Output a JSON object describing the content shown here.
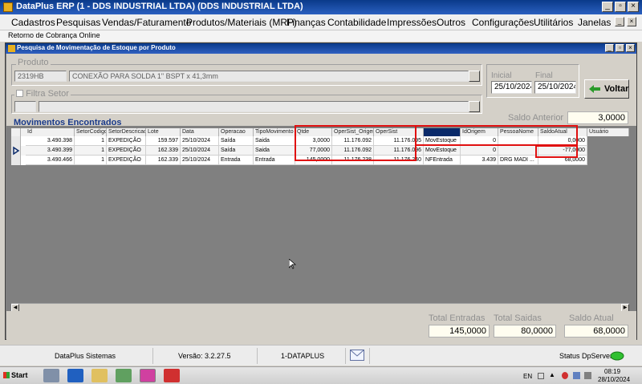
{
  "window": {
    "title": "DataPlus ERP (1 - DDS INDUSTRIAL LTDA)  (DDS INDUSTRIAL LTDA)"
  },
  "menu": [
    "Cadastros",
    "Pesquisas",
    "Vendas/Faturamento",
    "Produtos/Materiais (MRP)",
    "Finanças",
    "Contabilidade",
    "Impressões",
    "Outros",
    "Configurações",
    "Utilitários",
    "Janelas"
  ],
  "subbar": "Retorno de Cobrança Online",
  "child": {
    "title": "Pesquisa de Movimentação de Estoque por Produto"
  },
  "produto": {
    "label": "Produto",
    "code": "2319HB",
    "description": "CONEXÃO PARA SOLDA 1\" BSPT x 41,3mm"
  },
  "filtro_setor": {
    "label": "Filtra Setor"
  },
  "periodo": {
    "inicial_label": "Inicial",
    "inicial": "25/10/2024",
    "final_label": "Final",
    "final": "25/10/2024"
  },
  "voltar_label": "Voltar",
  "movimentos_title": "Movimentos Encontrados",
  "saldo_anterior": {
    "label": "Saldo Anterior",
    "value": "3,0000"
  },
  "grid": {
    "columns": [
      "Id",
      "SetorCodigo",
      "SetorDescricao",
      "Lote",
      "Data",
      "Operacao",
      "TipoMovimento",
      "Qtde",
      "OperSist_Origem",
      "OperSist",
      "Origem",
      "IdOrigem",
      "PessoaNome",
      "SaldoAtual",
      "Usuário"
    ],
    "rows": [
      [
        "3.490.398",
        "1",
        "EXPEDIÇÃO",
        "159.597",
        "25/10/2024",
        "Saída",
        "Saida",
        "3,0000",
        "11.176.092",
        "11.176.095",
        "MovEstoque",
        "0",
        "",
        "0,0000",
        ""
      ],
      [
        "3.490.399",
        "1",
        "EXPEDIÇÃO",
        "162.339",
        "25/10/2024",
        "Saída",
        "Saida",
        "77,0000",
        "11.176.092",
        "11.176.096",
        "MovEstoque",
        "0",
        "",
        "-77,0000",
        ""
      ],
      [
        "3.490.466",
        "1",
        "EXPEDIÇÃO",
        "162.339",
        "25/10/2024",
        "Entrada",
        "Entrada",
        "145,0000",
        "11.176.238",
        "11.176.240",
        "NFEntrada",
        "3.439",
        "DRG MADI ...",
        "68,0000",
        ""
      ]
    ],
    "current_row": 1
  },
  "totals": {
    "entradas_label": "Total Entradas",
    "entradas": "145,0000",
    "saidas_label": "Total Saidas",
    "saidas": "80,0000",
    "saldo_label": "Saldo Atual",
    "saldo": "68,0000"
  },
  "status": {
    "system": "DataPlus Sistemas",
    "version": "Versão: 3.2.27.5",
    "company": "1-DATAPLUS",
    "server": "Status DpServer"
  },
  "taskbar": {
    "start": "Start",
    "lang": "EN",
    "time": "08:19",
    "date": "28/10/2024"
  },
  "colors": {
    "title": "#0a3a8a",
    "section": "#1a3a8a",
    "highlight": "#e01010",
    "server_ok": "#30c030"
  }
}
